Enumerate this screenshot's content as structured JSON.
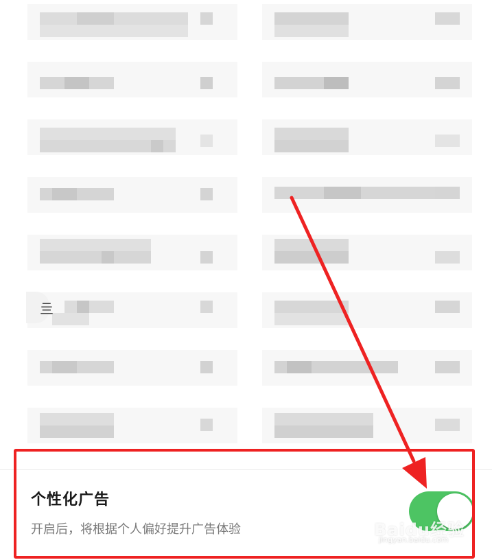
{
  "setting": {
    "title": "个性化广告",
    "description": "开启后，将根据个人偏好提升广告体验",
    "toggle_state": "on",
    "toggle_color": "#4dc463"
  },
  "annotation": {
    "highlight_color": "#ee2222"
  },
  "background": {
    "stub_glyph": "亖"
  },
  "watermark": {
    "main": "Baidu经验",
    "sub": "jingyan.baidu.com"
  }
}
